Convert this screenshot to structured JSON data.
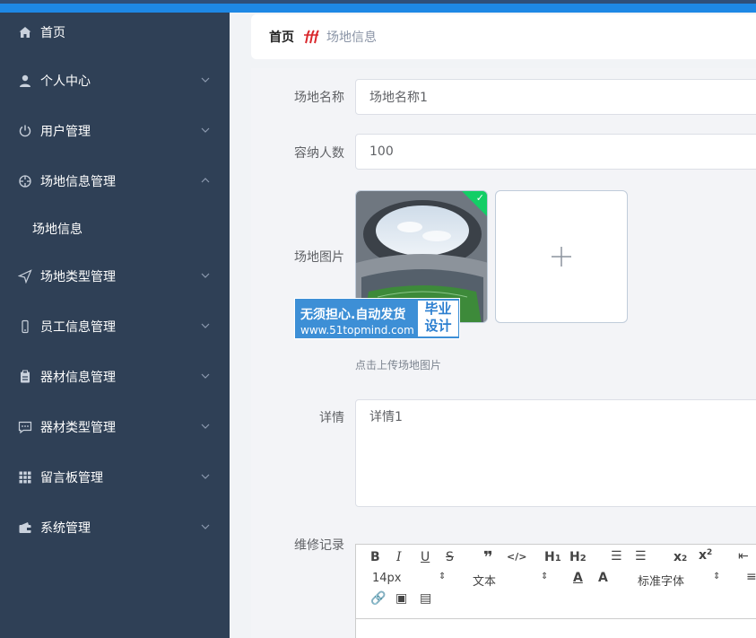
{
  "sidebar": {
    "items": [
      {
        "label": "首页",
        "icon": "home-icon"
      },
      {
        "label": "个人中心",
        "icon": "user-icon"
      },
      {
        "label": "用户管理",
        "icon": "power-icon"
      },
      {
        "label": "场地信息管理",
        "icon": "crosshair-icon"
      },
      {
        "label": "场地类型管理",
        "icon": "send-icon"
      },
      {
        "label": "员工信息管理",
        "icon": "phone-icon"
      },
      {
        "label": "器材信息管理",
        "icon": "clipboard-icon"
      },
      {
        "label": "器材类型管理",
        "icon": "message-icon"
      },
      {
        "label": "留言板管理",
        "icon": "grid-icon"
      },
      {
        "label": "系统管理",
        "icon": "wallet-icon"
      }
    ],
    "sub_item": "场地信息"
  },
  "breadcrumb": {
    "home": "首页",
    "current": "场地信息"
  },
  "form": {
    "name_label": "场地名称",
    "name_value": "场地名称1",
    "capacity_label": "容纳人数",
    "capacity_value": "100",
    "image_label": "场地图片",
    "image_tip": "点击上传场地图片",
    "detail_label": "详情",
    "detail_value": "详情1",
    "repair_label": "维修记录"
  },
  "editor": {
    "font_size": "14px",
    "text_type": "文本",
    "font_family": "标准字体"
  },
  "watermark": {
    "line1": "无须担心.自动发货",
    "line2": "www.51topmind.com",
    "right1": "毕业",
    "right2": "设计"
  },
  "colors": {
    "sidebar_bg": "#2f4056",
    "accent": "#1e88e5",
    "success": "#13ce66"
  }
}
